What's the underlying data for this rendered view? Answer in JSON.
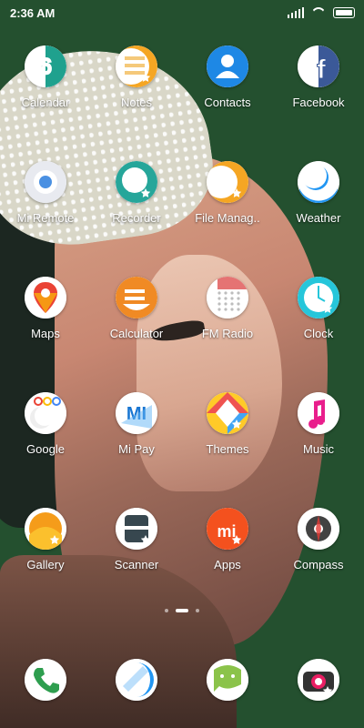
{
  "status": {
    "time": "2:36 AM"
  },
  "apps": [
    {
      "label": "Calendar",
      "icon": "calendar-icon",
      "color": "#1fa18e"
    },
    {
      "label": "Notes",
      "icon": "notes-icon",
      "color": "#f5a623"
    },
    {
      "label": "Contacts",
      "icon": "contacts-icon",
      "color": "#1e88e5"
    },
    {
      "label": "Facebook",
      "icon": "facebook-icon",
      "color": "#3b5998"
    },
    {
      "label": "Mi Remote",
      "icon": "remote-icon",
      "color": "#4a90e2"
    },
    {
      "label": "Recorder",
      "icon": "recorder-icon",
      "color": "#26a69a"
    },
    {
      "label": "File Manag..",
      "icon": "folder-icon",
      "color": "#f5a623"
    },
    {
      "label": "Weather",
      "icon": "weather-icon",
      "color": "#2196f3"
    },
    {
      "label": "Maps",
      "icon": "maps-pin-icon",
      "color": "#4285f4"
    },
    {
      "label": "Calculator",
      "icon": "calculator-icon",
      "color": "#f08a24"
    },
    {
      "label": "FM Radio",
      "icon": "radio-icon",
      "color": "#bdbdbd"
    },
    {
      "label": "Clock",
      "icon": "clock-icon",
      "color": "#26c6da"
    },
    {
      "label": "Google",
      "icon": "google-icon",
      "color": "#ea4335"
    },
    {
      "label": "Mi Pay",
      "icon": "mipay-icon",
      "color": "#1976d2"
    },
    {
      "label": "Themes",
      "icon": "themes-icon",
      "color": "#ef5350"
    },
    {
      "label": "Music",
      "icon": "music-icon",
      "color": "#e91e8c"
    },
    {
      "label": "Gallery",
      "icon": "gallery-icon",
      "color": "#f59c1a"
    },
    {
      "label": "Scanner",
      "icon": "scanner-icon",
      "color": "#37474f"
    },
    {
      "label": "Apps",
      "icon": "apps-store-icon",
      "color": "#f4511e"
    },
    {
      "label": "Compass",
      "icon": "compass-icon",
      "color": "#424242"
    }
  ],
  "dock": [
    {
      "icon": "phone-icon",
      "color": "#2e9e4f"
    },
    {
      "icon": "browser-icon",
      "color": "#2196f3"
    },
    {
      "icon": "messaging-icon",
      "color": "#8bc34a"
    },
    {
      "icon": "camera-icon",
      "color": "#333333"
    }
  ],
  "pages": {
    "count": 3,
    "current": 2
  }
}
